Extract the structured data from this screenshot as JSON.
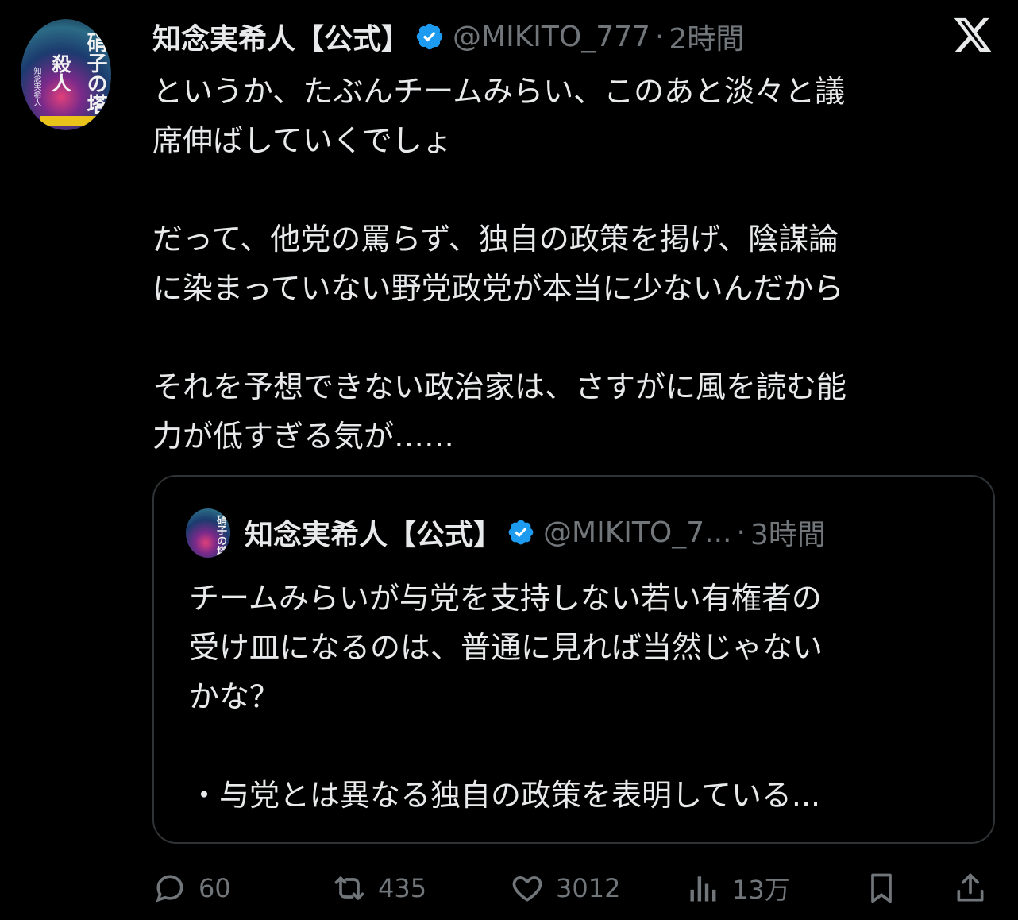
{
  "tweet": {
    "author": {
      "display_name": "知念実希人【公式】",
      "handle": "@MIKITO_777",
      "time": "2時間",
      "avatar": {
        "title_a": "硝子の塔",
        "title_b": "殺人",
        "title_c": "知念実希人"
      }
    },
    "paragraphs": [
      [
        "というか、たぶんチームみらい、このあと淡々と議",
        "席伸ばしていくでしょ"
      ],
      [
        "だって、他党の罵らず、独自の政策を掲げ、陰謀論",
        "に染まっていない野党政党が本当に少ないんだから"
      ],
      [
        "それを予想できない政治家は、さすがに風を読む能",
        "力が低すぎる気が……"
      ]
    ]
  },
  "quote": {
    "display_name": "知念実希人【公式】",
    "handle": "@MIKITO_7...",
    "time": "3時間",
    "avatar_text": "硝子の塔",
    "lines": [
      "チームみらいが与党を支持しない若い有権者の",
      "受け皿になるのは、普通に見れば当然じゃない",
      "かな？",
      "",
      "・与党とは異なる独自の政策を表明している..."
    ]
  },
  "separator": "·",
  "actions": {
    "replies": "60",
    "reposts": "435",
    "likes": "3012",
    "views": "13万"
  },
  "icons": [
    "x-logo-icon",
    "verified-badge-icon",
    "reply-icon",
    "repost-icon",
    "like-icon",
    "views-icon",
    "bookmark-icon",
    "share-icon"
  ],
  "colors": {
    "background": "#000000",
    "text": "#e7e9ea",
    "muted": "#71767b",
    "verified": "#1d9bf0",
    "border": "#2f3336"
  }
}
